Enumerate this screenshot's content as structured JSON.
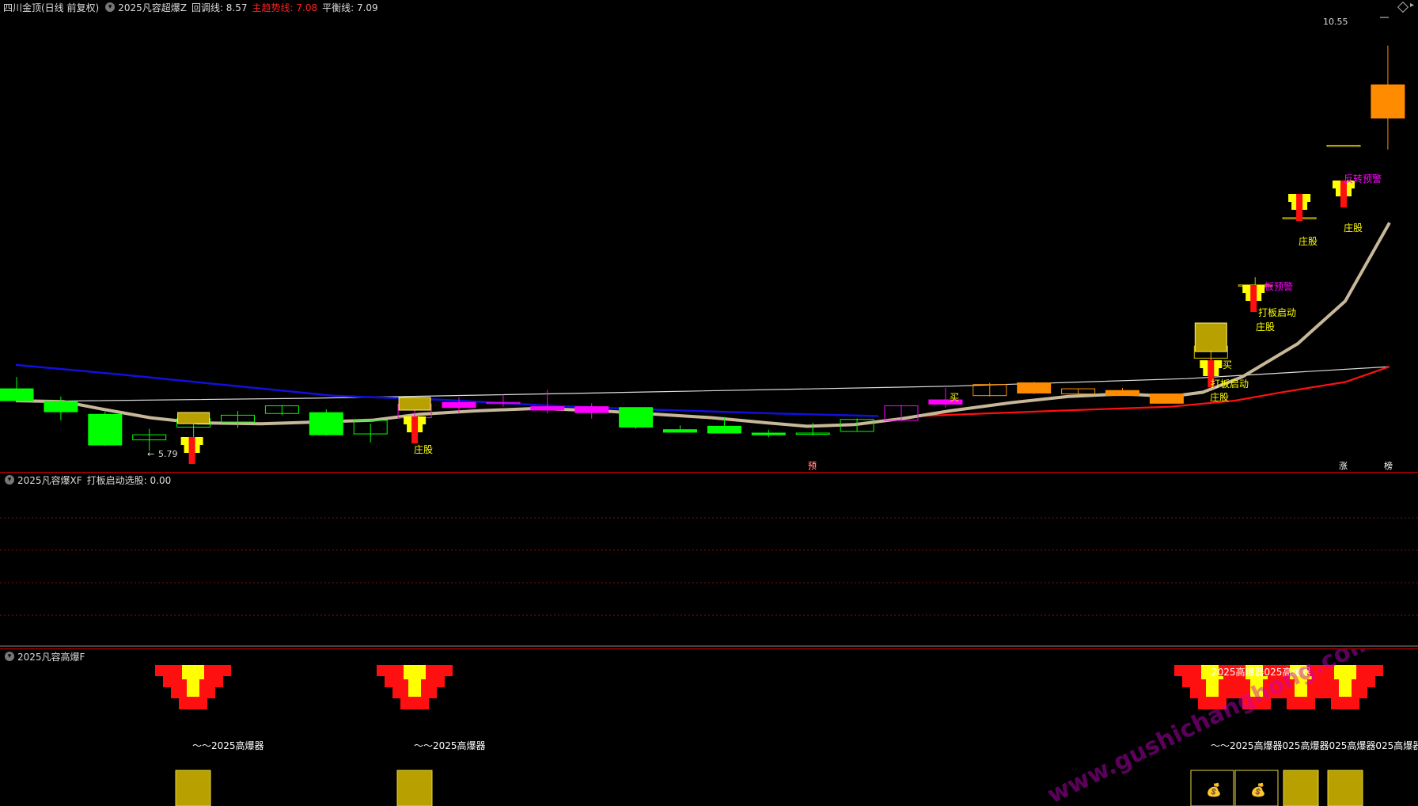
{
  "main_pane": {
    "header": {
      "stock": "四川金顶(日线 前复权)",
      "indicator_name": "2025凡容超爆Z",
      "items": [
        {
          "label": "回调线: 8.57",
          "color": "#dddddd"
        },
        {
          "label": "主趋势线: 7.08",
          "color": "#ff2020"
        },
        {
          "label": "平衡线: 7.09",
          "color": "#dddddd"
        }
      ]
    },
    "price_high_label": "10.55",
    "price_low_label": "5.79",
    "signal_labels": {
      "zhuanggu": "庄股",
      "daban": "打板启动",
      "fanzhuan": "反转预警",
      "ban_yujing": "板预警",
      "maimai": "买"
    },
    "bottom_markers": [
      "预",
      "涨",
      "榜"
    ]
  },
  "sub_pane_1": {
    "header": {
      "indicator_name": "2025凡容爆XF",
      "items": [
        {
          "label": "打板启动选股: 0.00",
          "color": "#dddddd"
        }
      ]
    }
  },
  "sub_pane_2": {
    "header": {
      "indicator_name": "2025凡容高爆F"
    },
    "label_single": "～～2025高爆器",
    "label_top_group": "2025高爆器025高爆器",
    "label_right_group": "～～2025高爆器025高爆器025高爆器025高爆器",
    "watermark": "www.gushichanghong.com"
  },
  "colors": {
    "up": "#00ff00",
    "down": "#00ff00",
    "magenta": "#ff00ff",
    "orange": "#ff8c00",
    "blue_ma": "#1010dd",
    "white_line": "#dddddd",
    "trend_red": "#ff1010",
    "balance": "#c8b89a"
  },
  "chart_data": {
    "type": "candlestick",
    "ylim": [
      5.6,
      10.9
    ],
    "candles": [
      {
        "o": 6.52,
        "h": 6.66,
        "l": 6.39,
        "c": 6.38,
        "s": "fill_g"
      },
      {
        "o": 6.37,
        "h": 6.43,
        "l": 6.15,
        "c": 6.25,
        "s": "fill_g"
      },
      {
        "o": 6.22,
        "h": 6.25,
        "l": 5.85,
        "c": 5.86,
        "s": "fill_g"
      },
      {
        "o": 5.98,
        "h": 6.05,
        "l": 5.79,
        "c": 5.92,
        "s": "hollow_g"
      },
      {
        "o": 6.07,
        "h": 6.19,
        "l": 5.89,
        "c": 6.17,
        "s": "hollow_g"
      },
      {
        "o": 6.13,
        "h": 6.26,
        "l": 6.06,
        "c": 6.21,
        "s": "hollow_g"
      },
      {
        "o": 6.23,
        "h": 6.33,
        "l": 6.21,
        "c": 6.32,
        "s": "hollow_g"
      },
      {
        "o": 6.24,
        "h": 6.28,
        "l": 5.97,
        "c": 5.98,
        "s": "fill_g"
      },
      {
        "o": 5.99,
        "h": 6.11,
        "l": 5.89,
        "c": 6.15,
        "s": "hollow_g"
      },
      {
        "o": 6.18,
        "h": 6.34,
        "l": 6.18,
        "c": 6.34,
        "s": "hollow_m"
      },
      {
        "o": 6.36,
        "h": 6.42,
        "l": 6.24,
        "c": 6.3,
        "s": "fill_m"
      },
      {
        "o": 6.35,
        "h": 6.45,
        "l": 6.31,
        "c": 6.36,
        "s": "hollow_m"
      },
      {
        "o": 6.31,
        "h": 6.51,
        "l": 6.23,
        "c": 6.27,
        "s": "fill_m"
      },
      {
        "o": 6.31,
        "h": 6.35,
        "l": 6.17,
        "c": 6.24,
        "s": "fill_m"
      },
      {
        "o": 6.3,
        "h": 6.3,
        "l": 6.05,
        "c": 6.07,
        "s": "fill_g"
      },
      {
        "o": 6.04,
        "h": 6.09,
        "l": 6.01,
        "c": 6.01,
        "s": "fill_g"
      },
      {
        "o": 6.08,
        "h": 6.19,
        "l": 6.01,
        "c": 6.0,
        "s": "fill_g"
      },
      {
        "o": 6.0,
        "h": 6.04,
        "l": 5.95,
        "c": 5.98,
        "s": "fill_g"
      },
      {
        "o": 5.99,
        "h": 6.12,
        "l": 5.97,
        "c": 6.0,
        "s": "hollow_g"
      },
      {
        "o": 6.02,
        "h": 6.17,
        "l": 6.02,
        "c": 6.16,
        "s": "hollow_g"
      },
      {
        "o": 6.15,
        "h": 6.33,
        "l": 6.14,
        "c": 6.32,
        "s": "hollow_m"
      },
      {
        "o": 6.34,
        "h": 6.53,
        "l": 6.3,
        "c": 6.39,
        "s": "fill_m"
      },
      {
        "o": 6.44,
        "h": 6.59,
        "l": 6.43,
        "c": 6.57,
        "s": "hollow_o"
      },
      {
        "o": 6.47,
        "h": 6.6,
        "l": 6.46,
        "c": 6.59,
        "s": "fill_o"
      },
      {
        "o": 6.46,
        "h": 6.52,
        "l": 6.46,
        "c": 6.52,
        "s": "hollow_o"
      },
      {
        "o": 6.44,
        "h": 6.53,
        "l": 6.44,
        "c": 6.5,
        "s": "fill_o"
      },
      {
        "o": 6.35,
        "h": 6.46,
        "l": 6.35,
        "c": 6.46,
        "s": "fill_o"
      },
      {
        "o": 6.88,
        "h": 7.08,
        "l": 6.79,
        "c": 7.02,
        "s": "hollow_y"
      },
      {
        "o": 7.74,
        "h": 7.83,
        "l": 7.73,
        "c": 7.73,
        "s": "hollow_y"
      },
      {
        "o": 8.53,
        "h": 8.53,
        "l": 8.53,
        "c": 8.53,
        "s": "hollow_y"
      },
      {
        "o": 9.38,
        "h": 9.38,
        "l": 9.38,
        "c": 9.38,
        "s": "hollow_y"
      },
      {
        "o": 10.09,
        "h": 10.55,
        "l": 9.33,
        "c": 9.7,
        "s": "fill_o"
      }
    ]
  }
}
